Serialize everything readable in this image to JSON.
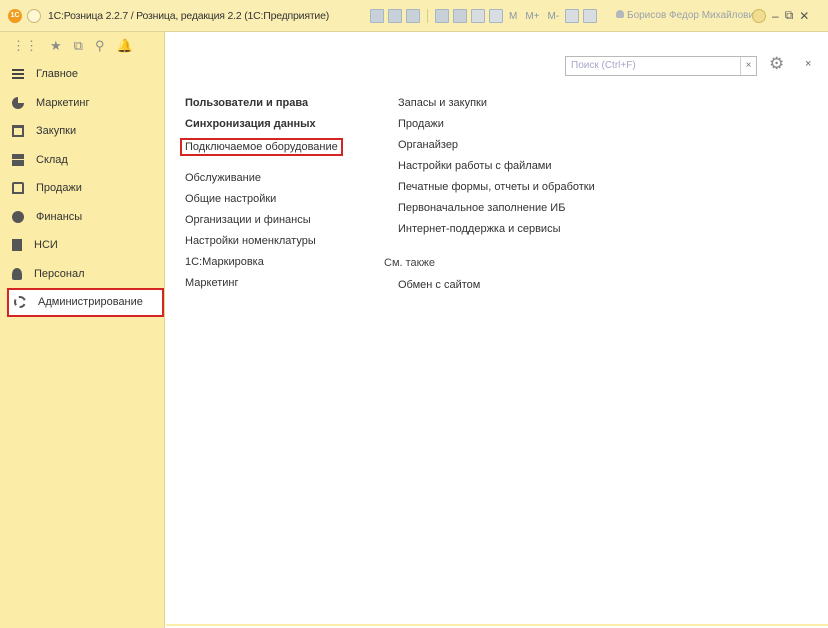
{
  "titlebar": {
    "logo": "1С",
    "title": "1С:Розница 2.2.7 / Розница, редакция 2.2 (1С:Предприятие)",
    "m1": "M",
    "m2": "M+",
    "m3": "M-",
    "user": "Борисов Федор Михайлович",
    "minimize": "–",
    "restore": "⧉",
    "close": "✕"
  },
  "sidebar": {
    "toolbar": [
      "⋮⋮",
      "★",
      "⧉",
      "⚲",
      "🔔"
    ],
    "items": [
      {
        "label": "Главное",
        "icon": "menu-icon"
      },
      {
        "label": "Маркетинг",
        "icon": "marketing-icon"
      },
      {
        "label": "Закупки",
        "icon": "purchases-icon"
      },
      {
        "label": "Склад",
        "icon": "warehouse-icon"
      },
      {
        "label": "Продажи",
        "icon": "sales-icon"
      },
      {
        "label": "Финансы",
        "icon": "finance-icon"
      },
      {
        "label": "НСИ",
        "icon": "nsi-icon"
      },
      {
        "label": "Персонал",
        "icon": "personnel-icon"
      },
      {
        "label": "Администрирование",
        "icon": "gear-icon",
        "active": true
      }
    ]
  },
  "search": {
    "placeholder": "Поиск (Ctrl+F)",
    "clear": "×"
  },
  "main": {
    "gear": "⚙",
    "close": "×",
    "left_links_top": [
      "Пользователи и права",
      "Синхронизация данных",
      "Подключаемое оборудование"
    ],
    "left_links_bottom": [
      "Обслуживание",
      "Общие настройки",
      "Организации и финансы",
      "Настройки номенклатуры",
      "1С:Маркировка",
      "Маркетинг"
    ],
    "right_links": [
      "Запасы и закупки",
      "Продажи",
      "Органайзер",
      "Настройки работы с файлами",
      "Печатные формы, отчеты и обработки",
      "Первоначальное заполнение ИБ",
      "Интернет-поддержка и сервисы"
    ],
    "see_also": "См. также",
    "see_also_link": "Обмен с сайтом"
  },
  "colors": {
    "sidebar": "#fbeda8",
    "titlebar": "#fbeeb2",
    "highlight": "#d42424"
  }
}
